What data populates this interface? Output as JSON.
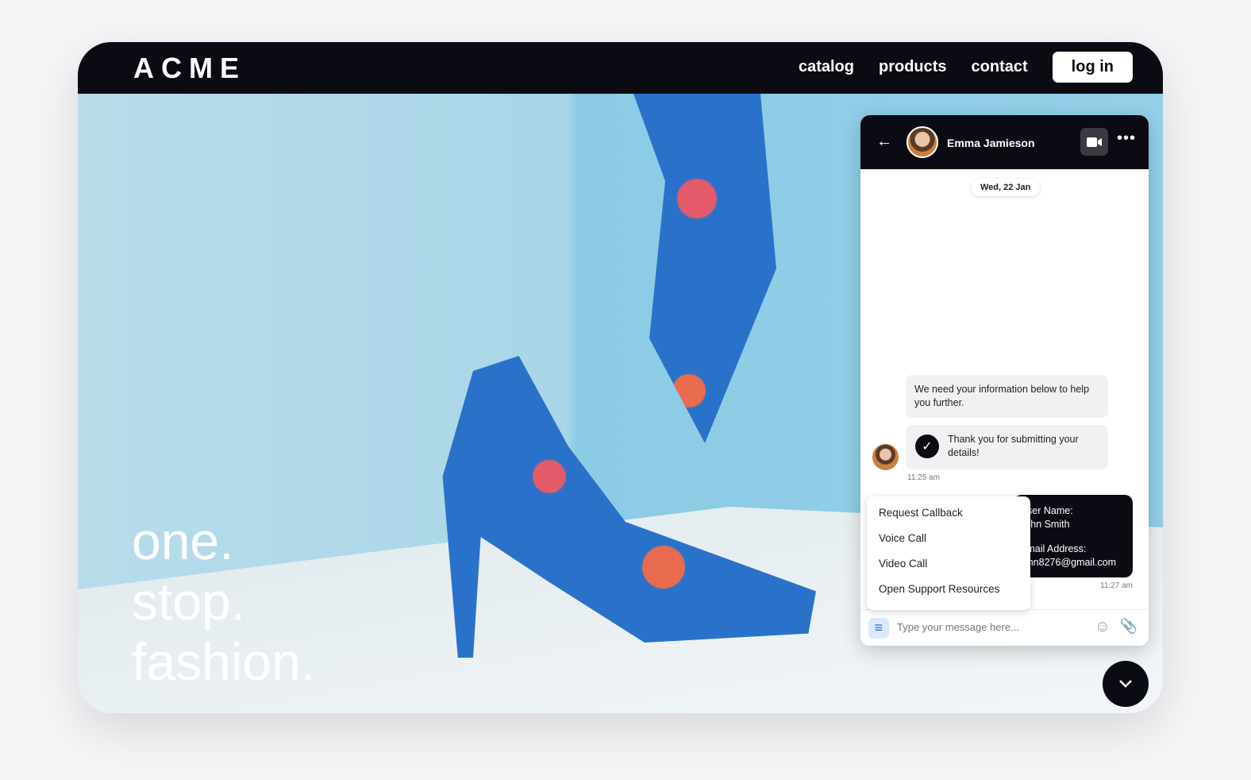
{
  "nav": {
    "logo": "ACME",
    "links": [
      "catalog",
      "products",
      "contact"
    ],
    "login": "log in"
  },
  "hero": {
    "tagline": [
      "one.",
      "stop.",
      "fashion."
    ]
  },
  "chat": {
    "contact_name": "Emma Jamieson",
    "date": "Wed, 22 Jan",
    "messages": [
      {
        "text": "We need your information below to help you further."
      },
      {
        "text": "Thank you for submitting your details!",
        "time": "11:25 am"
      },
      {
        "lines": [
          "User Name:",
          "John Smith",
          "",
          "Email Address:",
          "john8276@gmail.com"
        ],
        "time": "11:27 am"
      }
    ],
    "menu": [
      "Request Callback",
      "Voice Call",
      "Video Call",
      "Open Support Resources"
    ],
    "input_placeholder": "Type your message here..."
  },
  "colors": {
    "dark": "#0b0b14",
    "accent": "#2a72c9"
  }
}
